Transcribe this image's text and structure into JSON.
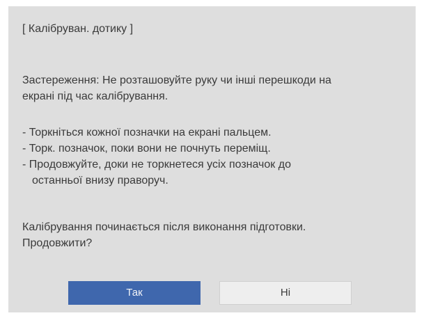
{
  "dialog": {
    "title": "[ Калібруван. дотику ]",
    "warning_line1": "Застереження: Не розташовуйте руку чи інші перешкоди на",
    "warning_line2": "екрані під час калібрування.",
    "steps": [
      "- Торкніться кожної позначки на екрані пальцем.",
      "- Торк. позначок, поки вони не почнуть переміщ.",
      "- Продовжуйте, доки не торкнетеся усіх позначок до",
      "останньої внизу праворуч."
    ],
    "question_line1": "Калібрування починається після виконання підготовки.",
    "question_line2": "Продовжити?",
    "yes_label": "Так",
    "no_label": "Ні"
  },
  "colors": {
    "dialog_background": "#dedede",
    "text": "#3a3a3a",
    "primary_button": "#3f67ad",
    "secondary_button": "#eeeeee"
  }
}
